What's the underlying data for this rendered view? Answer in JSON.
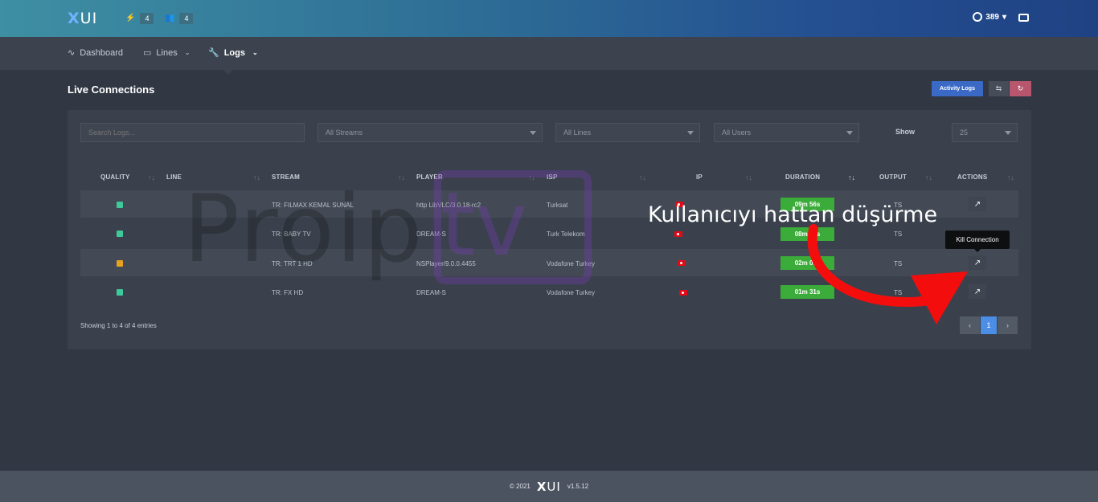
{
  "header": {
    "logo_x": "X",
    "logo_rest": "UI",
    "connections_count": "4",
    "users_count": "4",
    "credits": "389",
    "credits_caret": "▾"
  },
  "nav": {
    "dashboard": "Dashboard",
    "lines": "Lines",
    "logs": "Logs",
    "caret": "⌄"
  },
  "page": {
    "title": "Live Connections",
    "activity_logs": "Activity Logs"
  },
  "filters": {
    "search_placeholder": "Search Logs...",
    "streams": "All Streams",
    "lines": "All Lines",
    "users": "All Users",
    "show_label": "Show",
    "show_value": "25"
  },
  "table": {
    "columns": [
      "QUALITY",
      "LINE",
      "STREAM",
      "PLAYER",
      "ISP",
      "IP",
      "DURATION",
      "OUTPUT",
      "ACTIONS"
    ],
    "rows": [
      {
        "quality_color": "#3ec99a",
        "line": "",
        "stream": "TR: FILMAX KEMAL SUNAL",
        "player": "http LibVLC/3.0.18-rc2",
        "isp": "Turksat",
        "duration": "09m 56s",
        "output": "TS"
      },
      {
        "quality_color": "#3ec99a",
        "line": "",
        "stream": "TR: BABY TV",
        "player": "DREAM-S",
        "isp": "Turk Telekom",
        "duration": "08m 21s",
        "output": "TS"
      },
      {
        "quality_color": "#e7a21f",
        "line": "",
        "stream": "TR: TRT 1 HD",
        "player": "NSPlayer/9.0.0.4455",
        "isp": "Vodafone Turkey",
        "duration": "02m 01s",
        "output": "TS"
      },
      {
        "quality_color": "#3ec99a",
        "line": "",
        "stream": "TR: FX HD",
        "player": "DREAM-S",
        "isp": "Vodafone Turkey",
        "duration": "01m 31s",
        "output": "TS"
      }
    ]
  },
  "pagination": {
    "info": "Showing 1 to 4 of 4 entries",
    "prev": "‹",
    "page": "1",
    "next": "›"
  },
  "overlay": {
    "watermark_left": "Proip",
    "watermark_right": "tv",
    "annotation": "Kullanıcıyı hattan düşürme",
    "tooltip": "Kill Connection"
  },
  "footer": {
    "copyright": "© 2021",
    "logo_x": "X",
    "logo_rest": "UI",
    "version": "v1.5.12"
  }
}
